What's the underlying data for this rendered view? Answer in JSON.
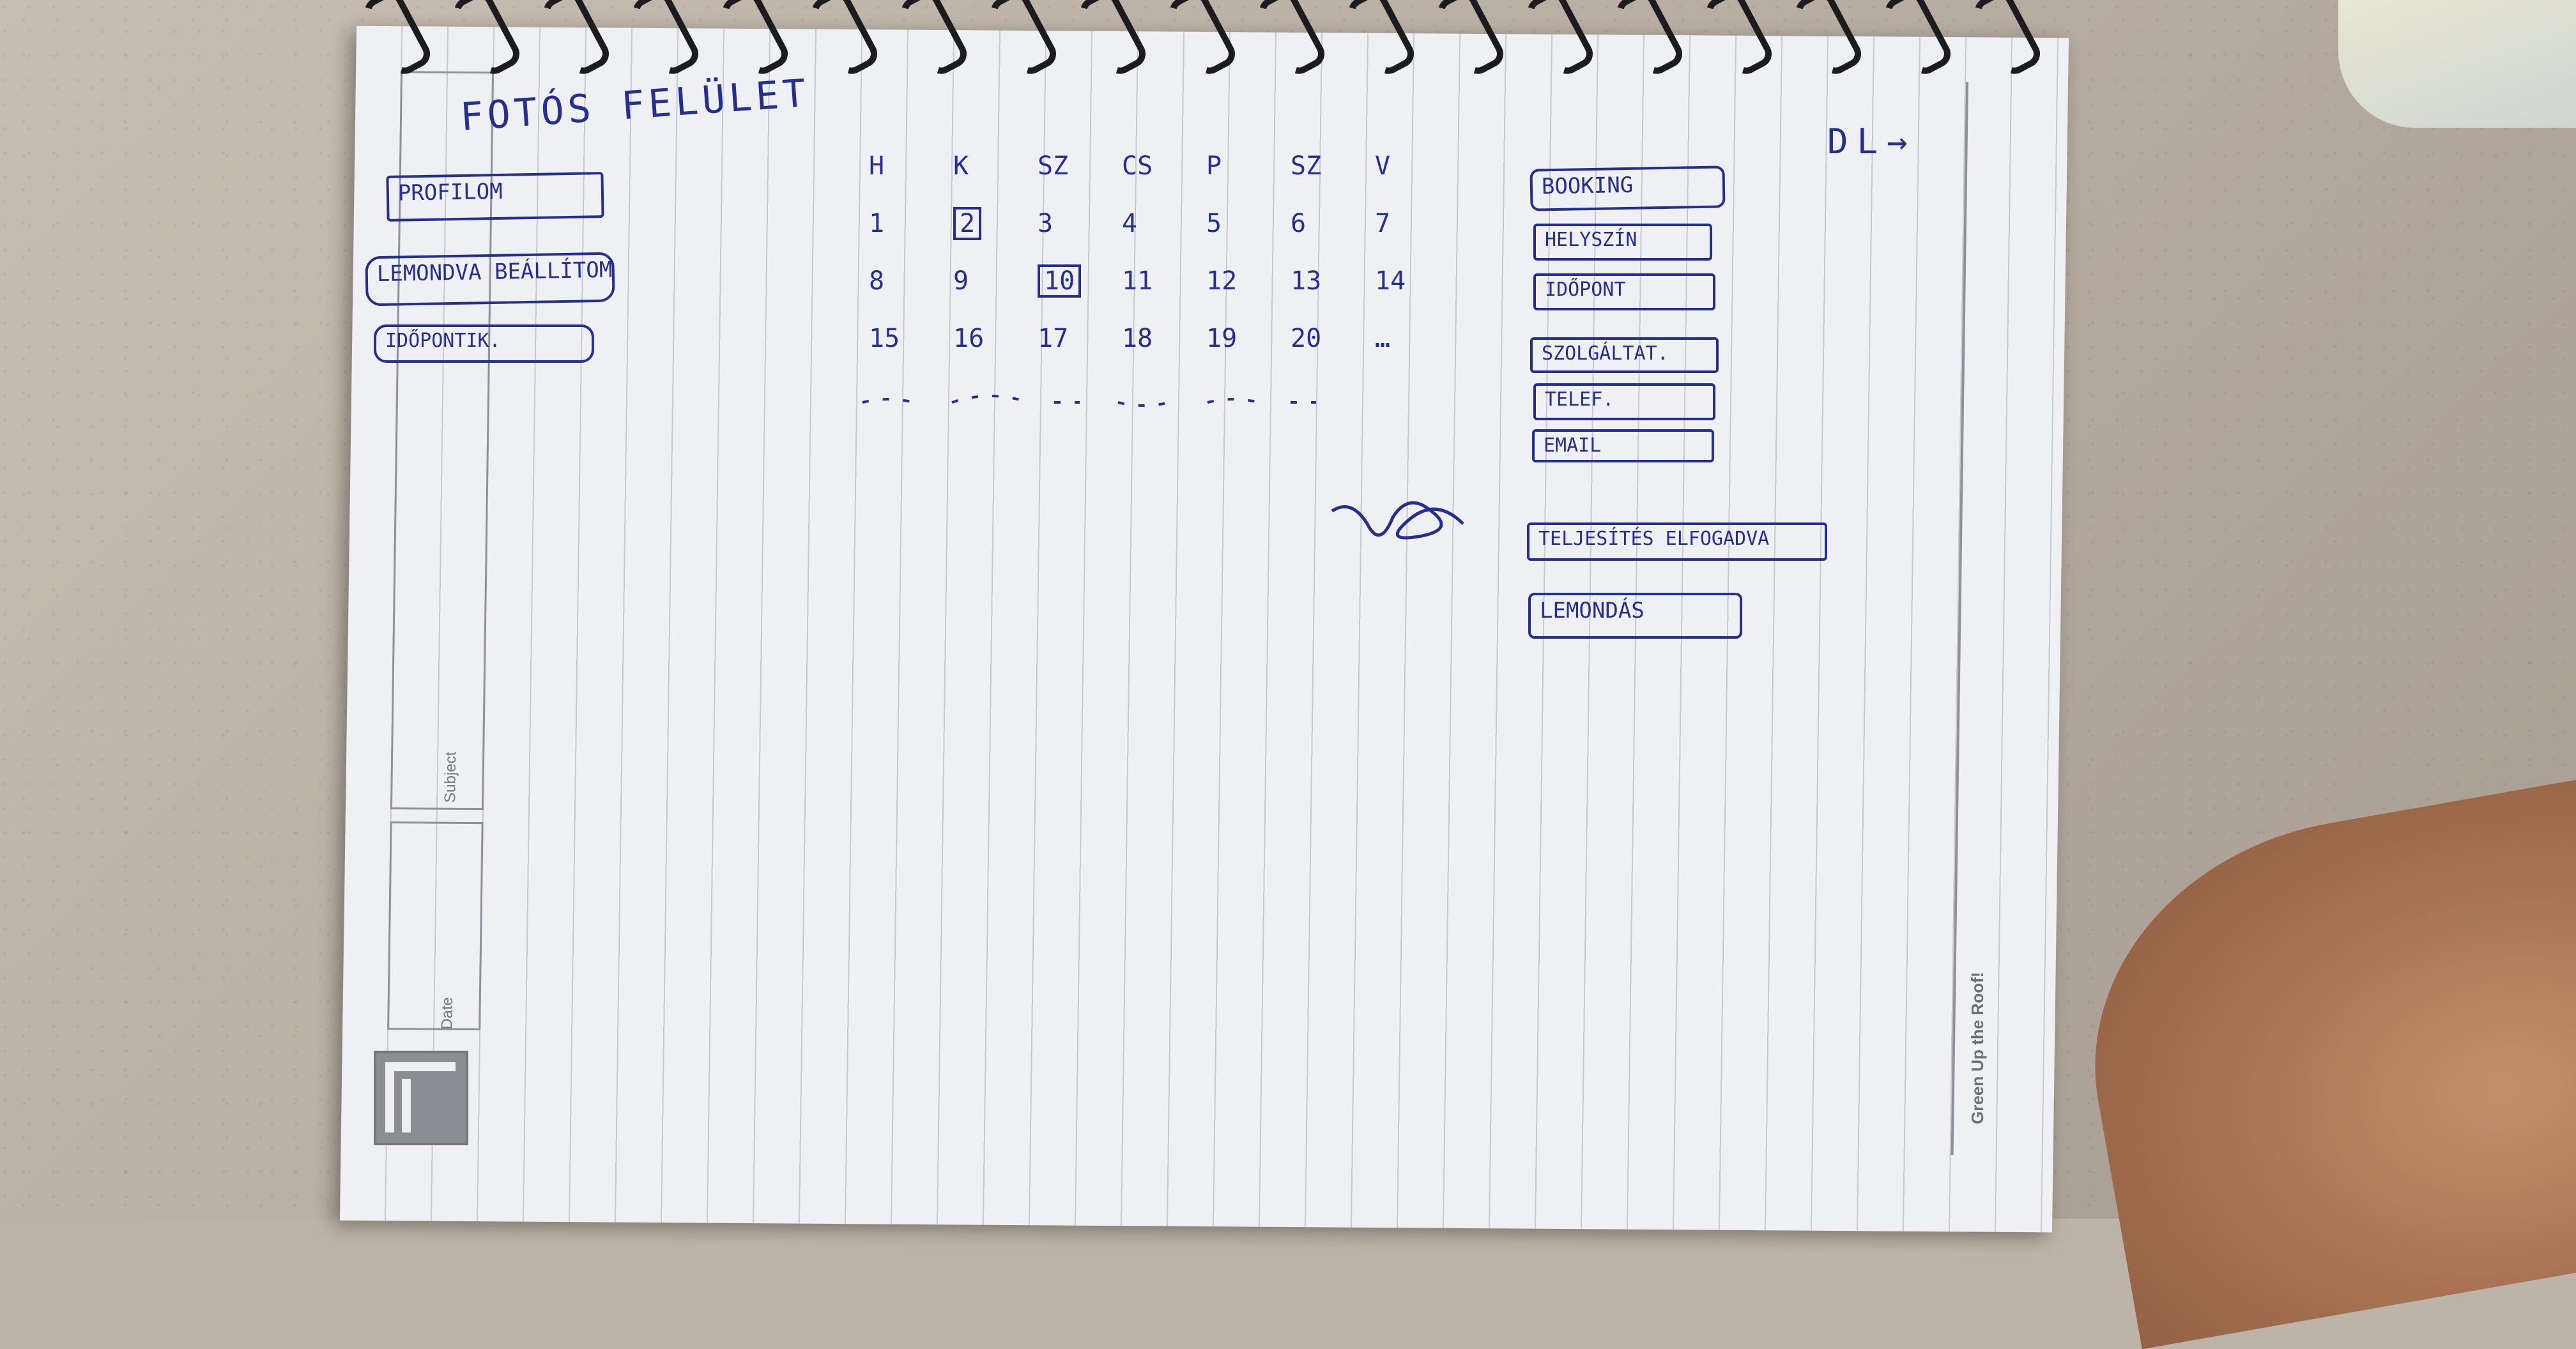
{
  "sketch": {
    "title": "FOTÓS FELÜLET",
    "corner_mark": "DL→",
    "left_menu": [
      {
        "label": "PROFILOM"
      },
      {
        "label": "LEMONDVA BEÁLLÍTOM"
      },
      {
        "label": "IDŐPONTIK."
      }
    ],
    "calendar": {
      "headers": [
        "H",
        "K",
        "SZ",
        "CS",
        "P",
        "SZ",
        "V"
      ],
      "rows": [
        [
          "1",
          "2",
          "3",
          "4",
          "5",
          "6",
          "7"
        ],
        [
          "8",
          "9",
          "10",
          "11",
          "12",
          "13",
          "14"
        ],
        [
          "15",
          "16",
          "17",
          "18",
          "19",
          "20",
          "…"
        ]
      ],
      "marked_days": [
        "2",
        "10"
      ]
    },
    "right_panel": [
      {
        "label": "BOOKING"
      },
      {
        "label": "HELYSZÍN"
      },
      {
        "label": "IDŐPONT"
      },
      {
        "label": "SZOLGÁLTAT."
      },
      {
        "label": "TELEF."
      },
      {
        "label": "EMAIL"
      },
      {
        "label": "TELJESÍTÉS ELFOGADVA"
      },
      {
        "label": "LEMONDÁS"
      }
    ]
  },
  "notebook": {
    "subject_label": "Subject",
    "date_label": "Date",
    "brand": "Green Up the Roof!"
  },
  "colors": {
    "ink": "#26308c",
    "paper": "#eef0f4",
    "background": "#bdb3a8"
  }
}
